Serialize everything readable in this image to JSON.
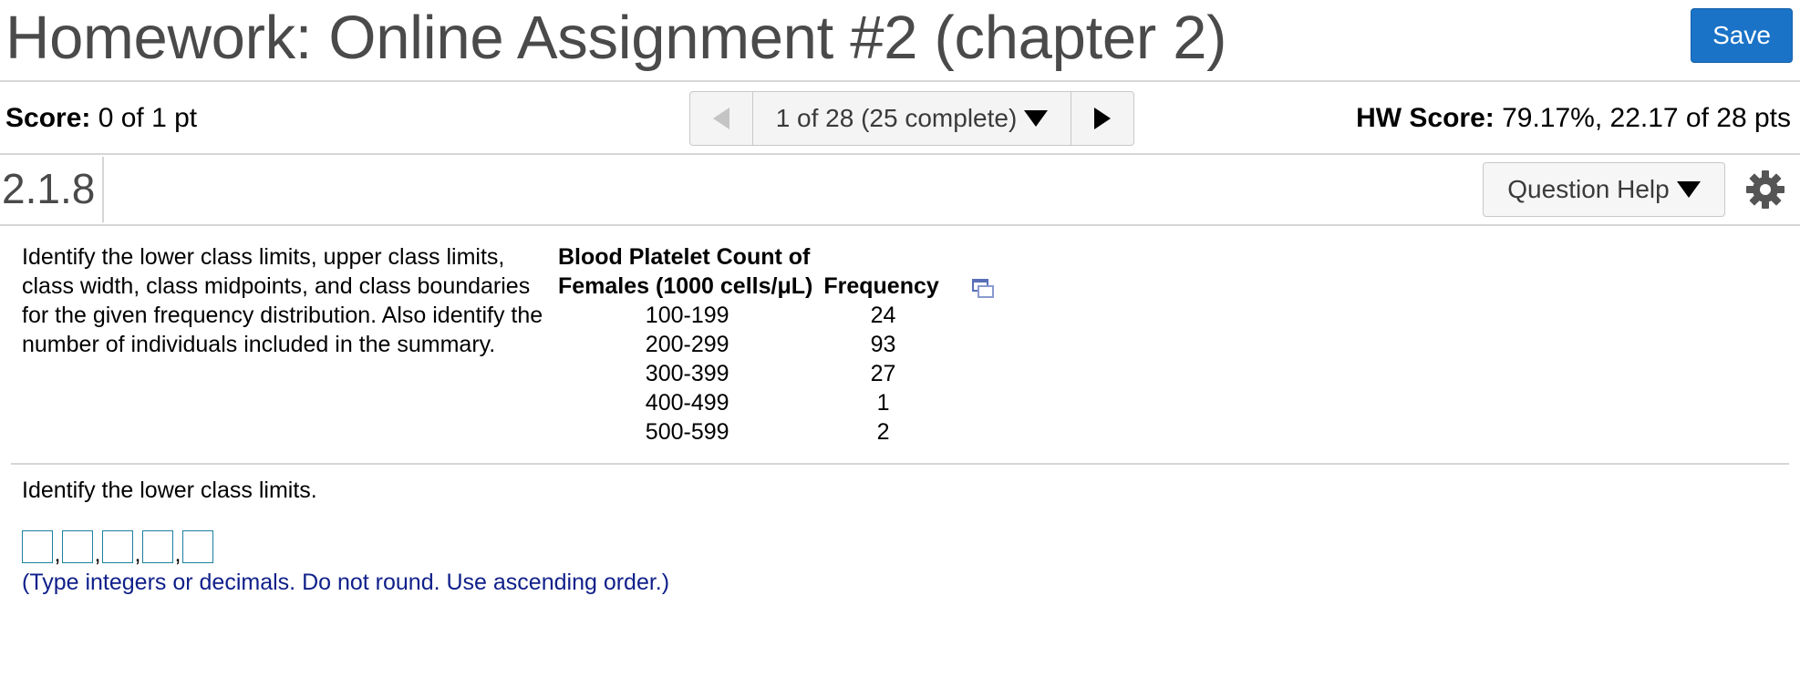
{
  "header": {
    "title": "Homework: Online Assignment #2 (chapter 2)",
    "save_label": "Save"
  },
  "scorebar": {
    "score_label": "Score:",
    "score_value": "0 of 1 pt",
    "nav_label": "1 of 28 (25 complete)",
    "hw_score_label": "HW Score:",
    "hw_score_value": "79.17%, 22.17 of 28 pts"
  },
  "question": {
    "number": "2.1.8",
    "help_label": "Question Help"
  },
  "problem": {
    "text": "Identify the lower class limits, upper class limits, class width, class midpoints, and class boundaries for the given frequency distribution. Also identify the number of individuals included in the summary.",
    "table": {
      "col1_header_line1": "Blood Platelet Count of",
      "col1_header_line2": "Females (1000 cells/μL)",
      "col2_header": "Frequency",
      "rows": [
        {
          "range": "100-199",
          "frequency": "24"
        },
        {
          "range": "200-299",
          "frequency": "93"
        },
        {
          "range": "300-399",
          "frequency": "27"
        },
        {
          "range": "400-499",
          "frequency": "1"
        },
        {
          "range": "500-599",
          "frequency": "2"
        }
      ]
    }
  },
  "answer": {
    "prompt": "Identify the lower class limits.",
    "separator": ",",
    "hint": "(Type integers or decimals. Do not round. Use ascending order.)"
  },
  "colors": {
    "save_button": "#1a73c7",
    "title_text": "#4a4a4a",
    "hint_text": "#10208a",
    "answer_border": "#1c7fa0",
    "divider": "#d6d6d6"
  },
  "icons": {
    "prev": "triangle-left-icon",
    "next": "triangle-right-icon",
    "dropdown": "chevron-down-icon",
    "settings": "gear-icon",
    "copy": "copy-data-icon"
  }
}
